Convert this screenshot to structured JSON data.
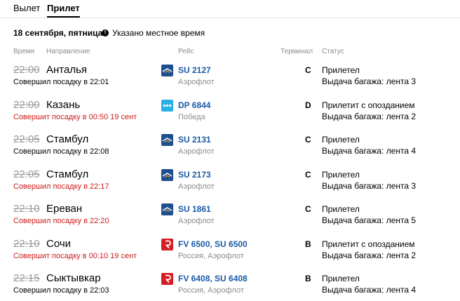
{
  "tabs": [
    {
      "label": "Вылет",
      "active": false
    },
    {
      "label": "Прилет",
      "active": true
    }
  ],
  "date_line": "18 сентября, пятница",
  "note": "Указано местное время",
  "headers": {
    "time": "Время",
    "direction": "Направление",
    "flight": "Рейс",
    "terminal": "Терминал",
    "status": "Статус"
  },
  "colors": {
    "accent_link": "#1a5aa8",
    "late": "#cc1b1b",
    "muted": "#8c8c8c"
  },
  "rows": [
    {
      "time": "22:00",
      "city": "Анталья",
      "boarding": "Совершил посадку в 22:01",
      "late": false,
      "logo": "aeroflot-logo",
      "flight": "SU 2127",
      "airline": "Аэрофлот",
      "terminal": "C",
      "status": "Прилетел",
      "baggage": "Выдача багажа: лента 3"
    },
    {
      "time": "22:00",
      "city": "Казань",
      "boarding": "Совершит посадку в 00:50 19 сент",
      "late": true,
      "logo": "pobeda-logo",
      "flight": "DP 6844",
      "airline": "Победа",
      "terminal": "D",
      "status": "Прилетит с опозданием",
      "baggage": "Выдача багажа: лента 2"
    },
    {
      "time": "22:05",
      "city": "Стамбул",
      "boarding": "Совершил посадку в 22:08",
      "late": false,
      "logo": "aeroflot-logo",
      "flight": "SU 2131",
      "airline": "Аэрофлот",
      "terminal": "C",
      "status": "Прилетел",
      "baggage": "Выдача багажа: лента 4"
    },
    {
      "time": "22:05",
      "city": "Стамбул",
      "boarding": "Совершил посадку в 22:17",
      "late": true,
      "logo": "aeroflot-logo",
      "flight": "SU 2173",
      "airline": "Аэрофлот",
      "terminal": "C",
      "status": "Прилетел",
      "baggage": "Выдача багажа: лента 3"
    },
    {
      "time": "22:10",
      "city": "Ереван",
      "boarding": "Совершил посадку в 22:20",
      "late": true,
      "logo": "aeroflot-logo",
      "flight": "SU 1861",
      "airline": "Аэрофлот",
      "terminal": "C",
      "status": "Прилетел",
      "baggage": "Выдача багажа: лента 5"
    },
    {
      "time": "22:10",
      "city": "Сочи",
      "boarding": "Совершит посадку в 00:10 19 сент",
      "late": true,
      "logo": "rossiya-logo",
      "flight": "FV 6500, SU 6500",
      "airline": "Россия, Аэрофлот",
      "terminal": "B",
      "status": "Прилетит с опозданием",
      "baggage": "Выдача багажа: лента 2"
    },
    {
      "time": "22:15",
      "city": "Сыктывкар",
      "boarding": "Совершил посадку в 22:03",
      "late": false,
      "logo": "rossiya-logo",
      "flight": "FV 6408, SU 6408",
      "airline": "Россия, Аэрофлот",
      "terminal": "B",
      "status": "Прилетел",
      "baggage": "Выдача багажа: лента 4"
    }
  ]
}
